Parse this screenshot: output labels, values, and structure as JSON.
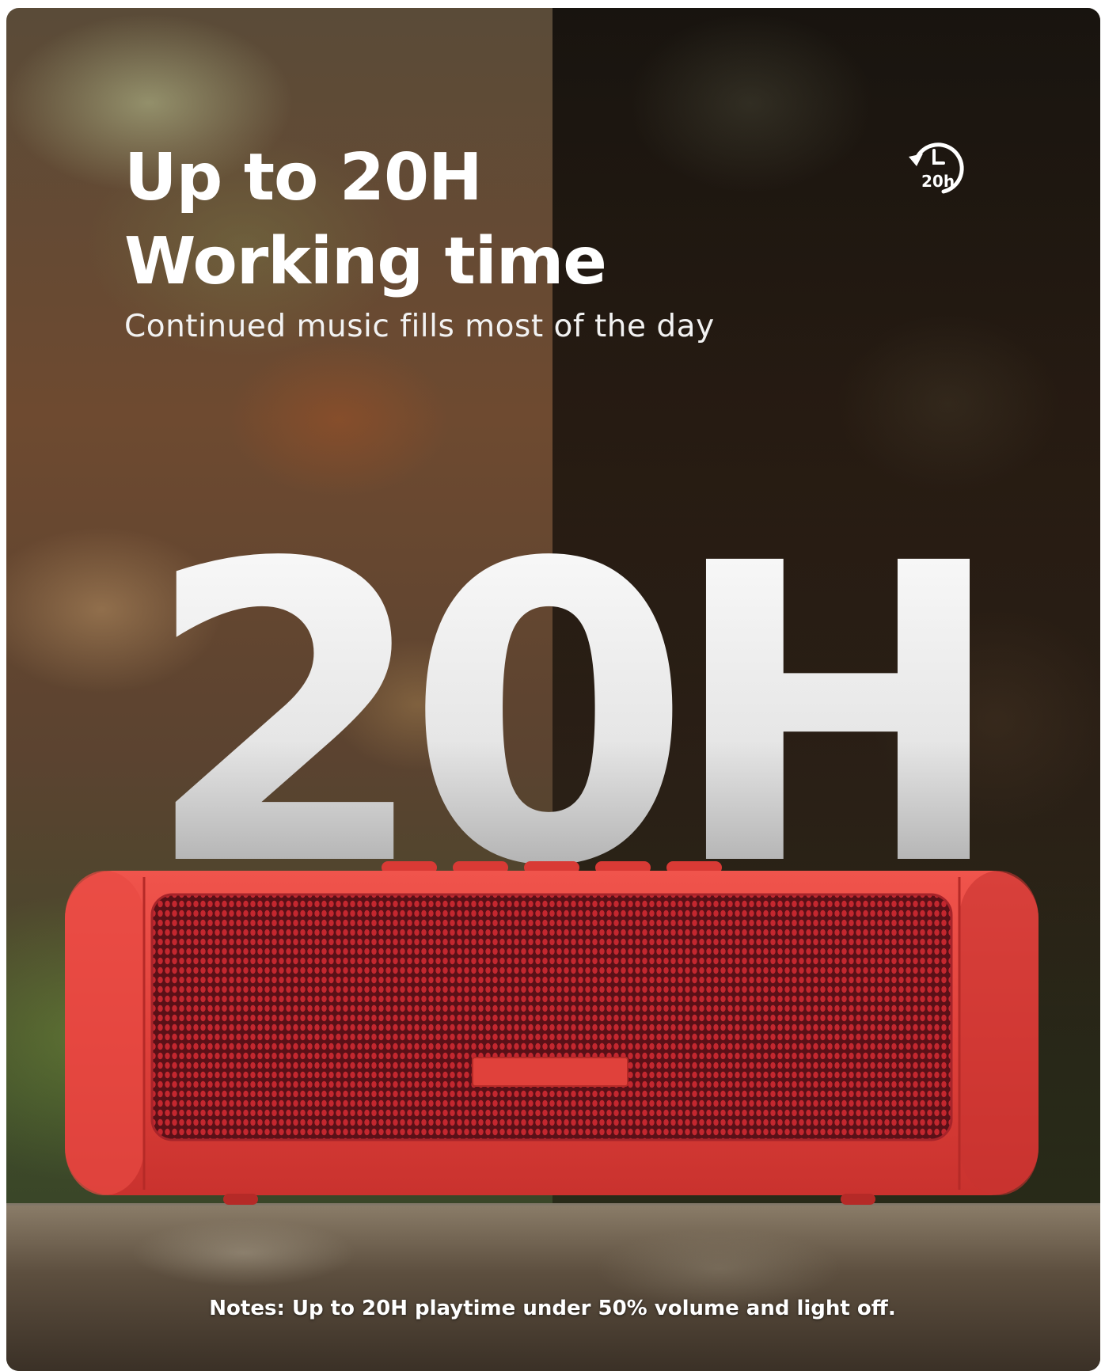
{
  "headline": {
    "line1": "Up to 20H",
    "line2": "Working time"
  },
  "subtitle": "Continued music fills most of the day",
  "badge": {
    "icon": "clock-20h-icon",
    "label": "20h"
  },
  "big_number": "20H",
  "notes": "Notes: Up to 20H playtime under 50% volume and light off.",
  "colors": {
    "speaker_body": "#e0413b",
    "speaker_grille": "#8a1a22",
    "text": "#ffffff"
  }
}
